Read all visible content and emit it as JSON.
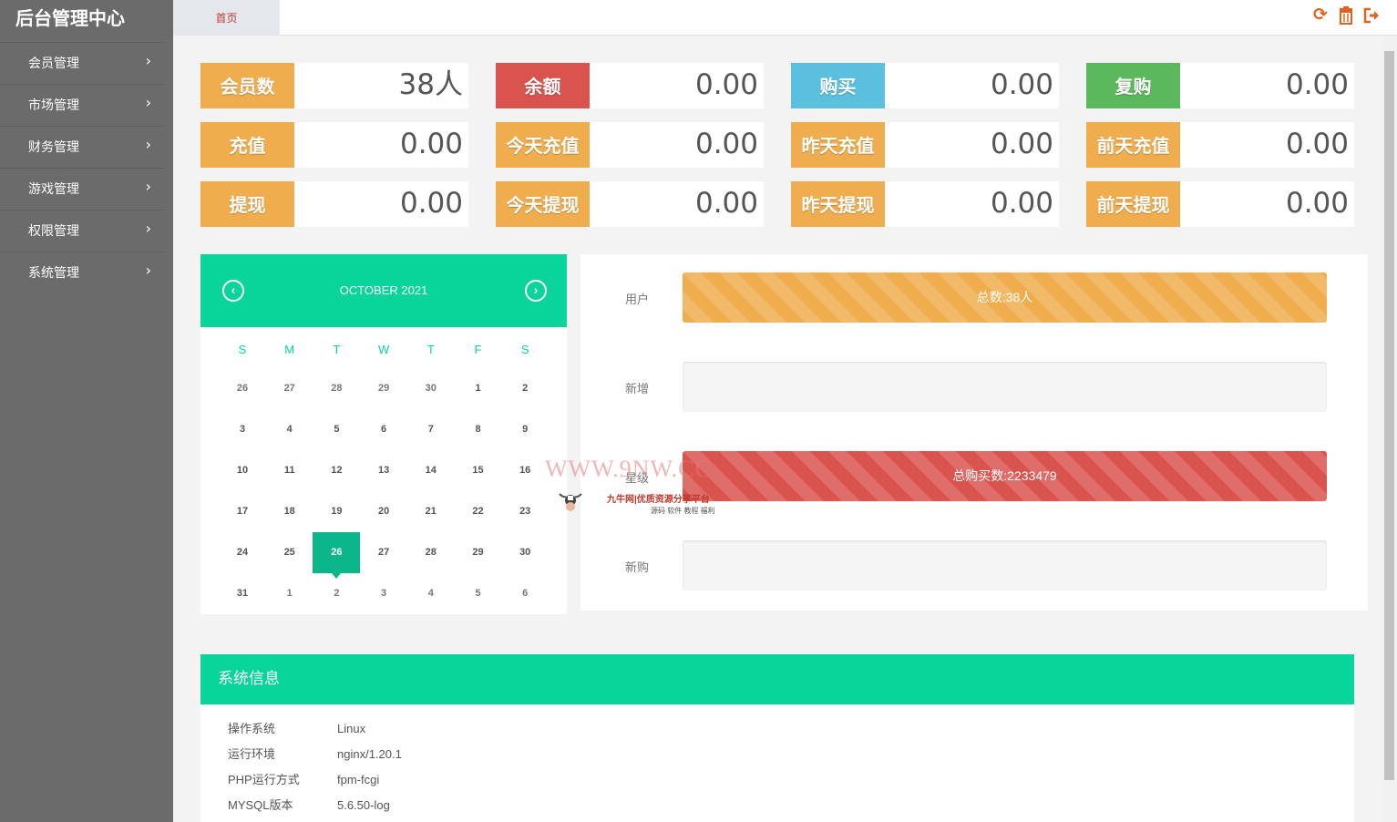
{
  "sidebar": {
    "title": "后台管理中心",
    "items": [
      {
        "label": "会员管理"
      },
      {
        "label": "市场管理"
      },
      {
        "label": "财务管理"
      },
      {
        "label": "游戏管理"
      },
      {
        "label": "权限管理"
      },
      {
        "label": "系统管理"
      }
    ],
    "chevron": "›"
  },
  "topbar": {
    "home_tab": "首页",
    "icons": [
      "refresh-icon",
      "trash-icon",
      "logout-icon"
    ]
  },
  "stats": [
    {
      "label": "会员数",
      "value": "38人",
      "color": "#f0ad4e"
    },
    {
      "label": "余额",
      "value": "0.00",
      "color": "#d9534f"
    },
    {
      "label": "购买",
      "value": "0.00",
      "color": "#5bc0de"
    },
    {
      "label": "复购",
      "value": "0.00",
      "color": "#5cb85c"
    },
    {
      "label": "充值",
      "value": "0.00",
      "color": "#f0ad4e"
    },
    {
      "label": "今天充值",
      "value": "0.00",
      "color": "#f0ad4e"
    },
    {
      "label": "昨天充值",
      "value": "0.00",
      "color": "#f0ad4e"
    },
    {
      "label": "前天充值",
      "value": "0.00",
      "color": "#f0ad4e"
    },
    {
      "label": "提现",
      "value": "0.00",
      "color": "#f0ad4e"
    },
    {
      "label": "今天提现",
      "value": "0.00",
      "color": "#f0ad4e"
    },
    {
      "label": "昨天提现",
      "value": "0.00",
      "color": "#f0ad4e"
    },
    {
      "label": "前天提现",
      "value": "0.00",
      "color": "#f0ad4e"
    }
  ],
  "calendar": {
    "title": "OCTOBER 2021",
    "prev": "‹",
    "next": "›",
    "weekdays": [
      "S",
      "M",
      "T",
      "W",
      "T",
      "F",
      "S"
    ],
    "weeks": [
      [
        "26",
        "27",
        "28",
        "29",
        "30",
        "1",
        "2"
      ],
      [
        "3",
        "4",
        "5",
        "6",
        "7",
        "8",
        "9"
      ],
      [
        "10",
        "11",
        "12",
        "13",
        "14",
        "15",
        "16"
      ],
      [
        "17",
        "18",
        "19",
        "20",
        "21",
        "22",
        "23"
      ],
      [
        "24",
        "25",
        "26",
        "27",
        "28",
        "29",
        "30"
      ],
      [
        "31",
        "1",
        "2",
        "3",
        "4",
        "5",
        "6"
      ]
    ],
    "selected": {
      "week": 4,
      "day": 2
    }
  },
  "progress": [
    {
      "label": "用户",
      "text": "总数:38人",
      "color": "orange",
      "fill_fraction": 1.0
    },
    {
      "label": "新增",
      "text": "",
      "color": "orange",
      "fill_fraction": 0.0
    },
    {
      "label": "星级",
      "text": "总购买数:2233479",
      "color": "red",
      "fill_fraction": 1.0
    },
    {
      "label": "新购",
      "text": "",
      "color": "red",
      "fill_fraction": 0.0
    }
  ],
  "sysinfo": {
    "title": "系统信息",
    "rows": [
      {
        "key": "操作系统",
        "value": "Linux"
      },
      {
        "key": "运行环境",
        "value": "nginx/1.20.1"
      },
      {
        "key": "PHP运行方式",
        "value": "fpm-fcgi"
      },
      {
        "key": "MYSQL版本",
        "value": "5.6.50-log"
      }
    ]
  },
  "watermark": {
    "main": "WWW.9NW.CC",
    "sub": "九牛网|优质资源分享平台",
    "sub2": "源码 软件 教程 福利"
  }
}
